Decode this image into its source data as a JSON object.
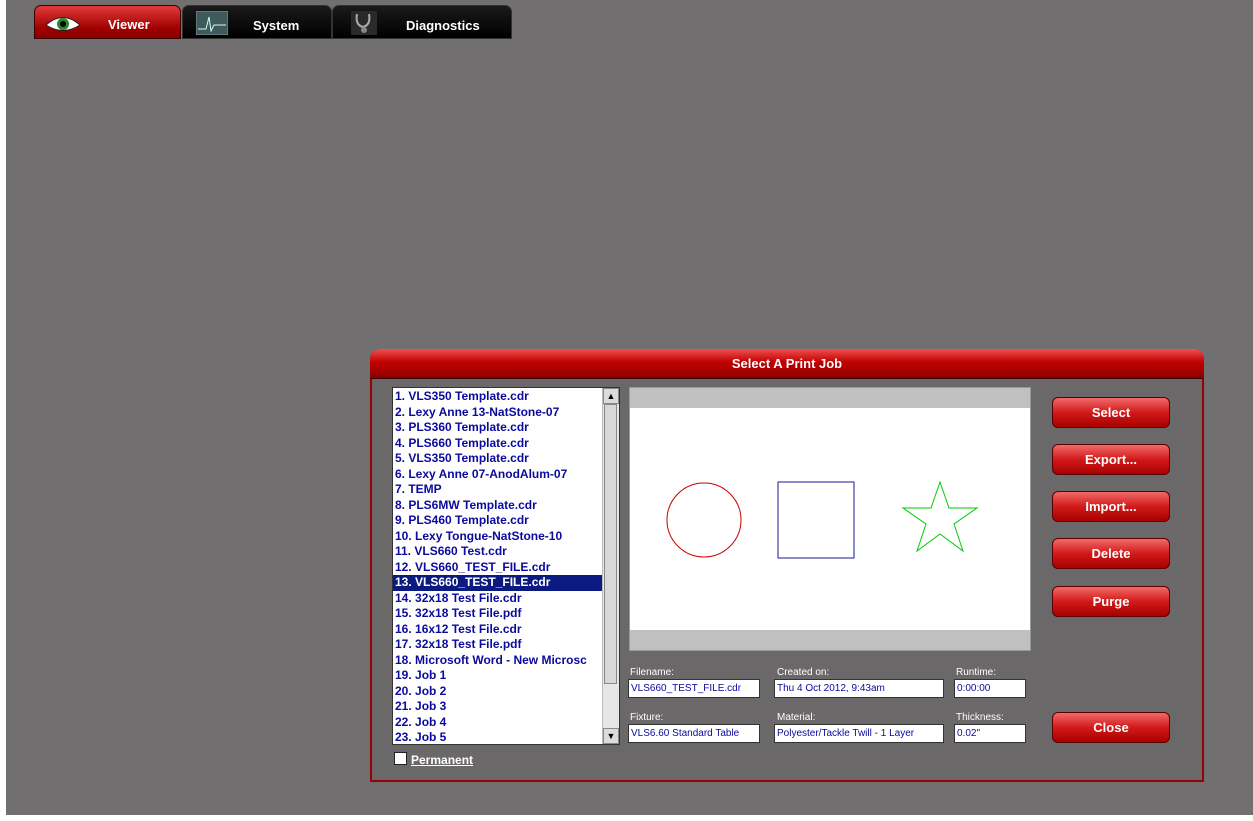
{
  "tabs": [
    {
      "label": "Viewer",
      "icon": "eye-icon",
      "active": true
    },
    {
      "label": "System",
      "icon": "graph-icon",
      "active": false
    },
    {
      "label": "Diagnostics",
      "icon": "stethoscope-icon",
      "active": false
    }
  ],
  "dialog": {
    "title": "Select A Print Job",
    "jobs": [
      "1. VLS350 Template.cdr",
      "2. Lexy Anne 13-NatStone-07",
      "3. PLS360 Template.cdr",
      "4. PLS660 Template.cdr",
      "5. VLS350 Template.cdr",
      "6. Lexy Anne 07-AnodAlum-07",
      "7. TEMP",
      "8. PLS6MW Template.cdr",
      "9. PLS460 Template.cdr",
      "10. Lexy Tongue-NatStone-10",
      "11. VLS660 Test.cdr",
      "12. VLS660_TEST_FILE.cdr",
      "13. VLS660_TEST_FILE.cdr",
      "14. 32x18 Test File.cdr",
      "15. 32x18 Test File.pdf",
      "16. 16x12 Test File.cdr",
      "17. 32x18 Test File.pdf",
      "18. Microsoft Word - New Microsc",
      "19. Job 1",
      "20. Job 2",
      "21. Job 3",
      "22. Job 4",
      "23. Job 5"
    ],
    "selected_index": 12,
    "permanent_label": "Permanent",
    "permanent_checked": false,
    "fields": {
      "filename_label": "Filename:",
      "filename_value": "VLS660_TEST_FILE.cdr",
      "created_label": "Created on:",
      "created_value": "Thu 4 Oct 2012,  9:43am",
      "runtime_label": "Runtime:",
      "runtime_value": "0:00:00",
      "fixture_label": "Fixture:",
      "fixture_value": "VLS6.60 Standard Table",
      "material_label": "Material:",
      "material_value": "Polyester/Tackle Twill - 1 Layer",
      "thickness_label": "Thickness:",
      "thickness_value": "0.02\""
    },
    "buttons": {
      "select": "Select",
      "export": "Export...",
      "import": "Import...",
      "delete": "Delete",
      "purge": "Purge",
      "close": "Close"
    },
    "preview_shapes": [
      {
        "shape": "circle",
        "color": "#cc0000"
      },
      {
        "shape": "square",
        "color": "#1a1a8c"
      },
      {
        "shape": "star",
        "color": "#00cc00"
      }
    ]
  }
}
